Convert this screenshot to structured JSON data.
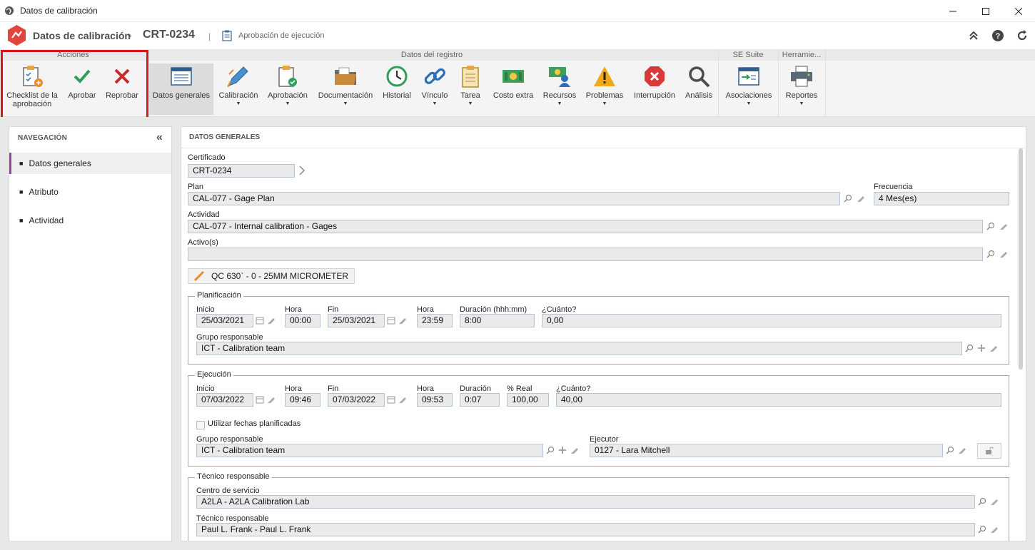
{
  "window": {
    "title": "Datos de calibración"
  },
  "header": {
    "title": "Datos de calibración",
    "chevron": "›",
    "record_code": "CRT-0234",
    "separator": "|",
    "subtitle": "Aprobación de ejecución"
  },
  "ribbon": {
    "groups": {
      "acciones": "Acciones",
      "datos_registro": "Datos del registro",
      "se_suite": "SE Suite",
      "herramientas": "Herramie..."
    },
    "buttons": {
      "checklist": "Checklist de la aprobación",
      "aprobar": "Aprobar",
      "reprobar": "Reprobar",
      "datos_generales": "Datos generales",
      "calibracion": "Calibración",
      "aprobacion": "Aprobación",
      "documentacion": "Documentación",
      "historial": "Historial",
      "vinculo": "Vínculo",
      "tarea": "Tarea",
      "costo_extra": "Costo extra",
      "recursos": "Recursos",
      "problemas": "Problemas",
      "interrupcion": "Interrupción",
      "analisis": "Análisis",
      "asociaciones": "Asociaciones",
      "reportes": "Reportes"
    }
  },
  "nav": {
    "heading": "NAVEGACIÓN",
    "collapse": "«",
    "items": [
      {
        "label": "Datos generales",
        "active": true
      },
      {
        "label": "Atributo",
        "active": false
      },
      {
        "label": "Actividad",
        "active": false
      }
    ]
  },
  "form": {
    "heading": "DATOS GENERALES",
    "certificado": {
      "label": "Certificado",
      "value": "CRT-0234"
    },
    "plan": {
      "label": "Plan",
      "value": "CAL-077 - Gage Plan"
    },
    "frecuencia": {
      "label": "Frecuencia",
      "value": "4 Mes(es)"
    },
    "actividad": {
      "label": "Actividad",
      "value": "CAL-077 - Internal calibration - Gages"
    },
    "activos": {
      "label": "Activo(s)",
      "value": ""
    },
    "asset_chip": "QC 630` - 0 - 25MM MICROMETER",
    "planificacion": {
      "legend": "Planificación",
      "inicio_label": "Inicio",
      "inicio": "25/03/2021",
      "hora_ini_label": "Hora",
      "hora_ini": "00:00",
      "fin_label": "Fin",
      "fin": "25/03/2021",
      "hora_fin_label": "Hora",
      "hora_fin": "23:59",
      "duracion_label": "Duración (hhh:mm)",
      "duracion": "8:00",
      "cuanto_label": "¿Cuánto?",
      "cuanto": "0,00",
      "grupo_label": "Grupo responsable",
      "grupo": "ICT - Calibration team"
    },
    "ejecucion": {
      "legend": "Ejecución",
      "inicio_label": "Inicio",
      "inicio": "07/03/2022",
      "hora_ini_label": "Hora",
      "hora_ini": "09:46",
      "fin_label": "Fin",
      "fin": "07/03/2022",
      "hora_fin_label": "Hora",
      "hora_fin": "09:53",
      "duracion_label": "Duración",
      "duracion": "0:07",
      "real_label": "% Real",
      "real": "100,00",
      "cuanto_label": "¿Cuánto?",
      "cuanto": "40,00",
      "utilizar_label": "Utilizar fechas planificadas",
      "grupo_label": "Grupo responsable",
      "grupo": "ICT - Calibration team",
      "ejecutor_label": "Ejecutor",
      "ejecutor": "0127 - Lara Mitchell"
    },
    "tecnico": {
      "legend": "Técnico responsable",
      "centro_label": "Centro de servicio",
      "centro": "A2LA - A2LA Calibration Lab",
      "tecnico_label": "Técnico responsable",
      "tecnico": "Paul L. Frank - Paul L. Frank"
    }
  },
  "colors": {
    "highlight": "#d9141b",
    "nav_active": "#8c4c9c",
    "approve": "#2e9e5b",
    "reject": "#c92b2b"
  }
}
